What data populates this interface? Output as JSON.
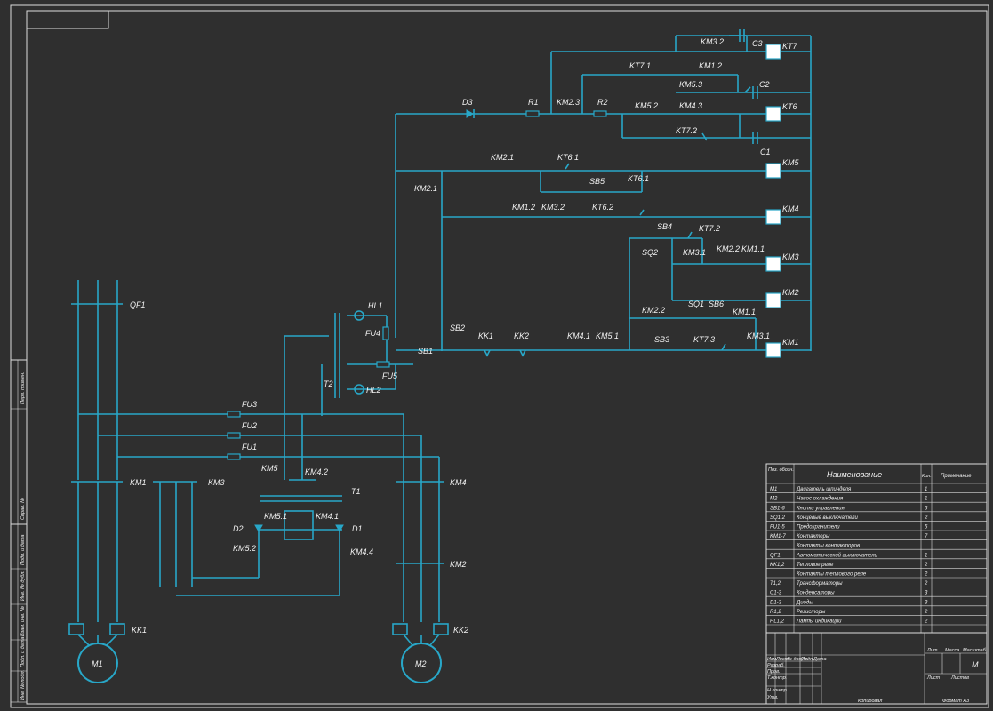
{
  "labels": {
    "kt7": "KT7",
    "km32": "KM3.2",
    "c3": "C3",
    "kt71": "KT7.1",
    "km12_top": "KM1.2",
    "km53": "KM5.3",
    "c2": "C2",
    "d3": "D3",
    "r1": "R1",
    "km23": "KM2.3",
    "r2": "R2",
    "km52_top": "KM5.2",
    "km43": "KM4.3",
    "kt6": "KT6",
    "kt72_top": "KT7.2",
    "c1": "C1",
    "km21_top": "KM2.1",
    "kt61": "KT6.1",
    "km5": "KM5",
    "km21_left": "KM2.1",
    "sb5": "SB5",
    "kt61b": "KT6.1",
    "km12_mid": "KM1.2",
    "km32_mid": "KM3.2",
    "kt62": "KT6.2",
    "km4": "KM4",
    "sb4": "SB4",
    "kt72": "KT7.2",
    "sq2": "SQ2",
    "km31_mid": "KM3.1",
    "km22": "KM2.2",
    "km11": "KM1.1",
    "km3": "KM3",
    "km2": "KM2",
    "km22b": "KM2.2",
    "sq1": "SQ1",
    "sb6": "SB6",
    "km11b": "KM1.1",
    "sb2": "SB2",
    "kk1": "KK1",
    "kk2": "KK2",
    "km41": "KM4.1",
    "km51": "KM5.1",
    "sb3": "SB3",
    "kt73": "KT7.3",
    "km31": "KM3.1",
    "km1": "KM1",
    "hl1": "HL1",
    "fu4": "FU4",
    "sb1": "SB1",
    "t2": "T2",
    "fu5": "FU5",
    "hl2": "HL2",
    "qf1": "QF1",
    "fu3": "FU3",
    "fu2": "FU2",
    "fu1": "FU1",
    "km5_lower": "KM5",
    "km42": "KM4.2",
    "km1_lower": "KM1",
    "km3_lower": "KM3",
    "t1": "T1",
    "km51_lower": "KM5.1",
    "km41_lower": "KM4.1",
    "d2": "D2",
    "d1": "D1",
    "km52": "KM5.2",
    "km44": "KM4.4",
    "km4_lower": "KM4",
    "km2_lower": "KM2",
    "kk1_lower": "KK1",
    "kk2_lower": "KK2",
    "m1": "M1",
    "m2": "M2"
  },
  "bom": {
    "header": {
      "pos": "Поз. обозн.",
      "name": "Наименование",
      "qty": "Кол.",
      "note": "Примечание"
    },
    "rows": [
      {
        "pos": "M1",
        "name": "Двигатель шпинделя",
        "qty": "1"
      },
      {
        "pos": "M2",
        "name": "Насос охлаждения",
        "qty": "1"
      },
      {
        "pos": "SB1-6",
        "name": "Кнопки управления",
        "qty": "6"
      },
      {
        "pos": "SQ1,2",
        "name": "Концевые выключатели",
        "qty": "2"
      },
      {
        "pos": "FU1-5",
        "name": "Предохранители",
        "qty": "5"
      },
      {
        "pos": "KM1-7",
        "name": "Контакторы",
        "qty": "7"
      },
      {
        "pos": "",
        "name": "Контакты контакторов",
        "qty": ""
      },
      {
        "pos": "QF1",
        "name": "Автоматический выключатель",
        "qty": "1"
      },
      {
        "pos": "KK1,2",
        "name": "Тепловое реле",
        "qty": "2"
      },
      {
        "pos": "",
        "name": "Контакты теплового реле",
        "qty": "2"
      },
      {
        "pos": "T1,2",
        "name": "Трансформаторы",
        "qty": "2"
      },
      {
        "pos": "C1-3",
        "name": "Конденсаторы",
        "qty": "3"
      },
      {
        "pos": "D1-3",
        "name": "Диоды",
        "qty": "3"
      },
      {
        "pos": "R1,2",
        "name": "Резисторы",
        "qty": "2"
      },
      {
        "pos": "HL1,2",
        "name": "Лампы индикации",
        "qty": "2"
      }
    ]
  },
  "title_block": {
    "designer_cols": [
      "Изм.",
      "Лист",
      "№ докум.",
      "Подп.",
      "Дата"
    ],
    "roles": [
      "Разраб.",
      "Пров.",
      "Т.контр.",
      "Н.контр.",
      "Утв."
    ],
    "lit": "Лит.",
    "mass": "Масса",
    "scale": "Масштаб",
    "scale_value": "М",
    "sheet": "Лист",
    "sheets": "Листов",
    "footer_copy": "Копировал",
    "footer_format": "Формат А3"
  },
  "side_stamp": [
    "Перв. примен.",
    "Справ. №",
    "Подп. и дата",
    "Инв. № дубл.",
    "Взам. инв. №",
    "Подп. и дата",
    "Инв. № подл."
  ],
  "colors": {
    "wire": "#28a7c8",
    "background": "#2f2f2f",
    "frame": "#dcdcdc",
    "text": "#f2f2f2"
  }
}
